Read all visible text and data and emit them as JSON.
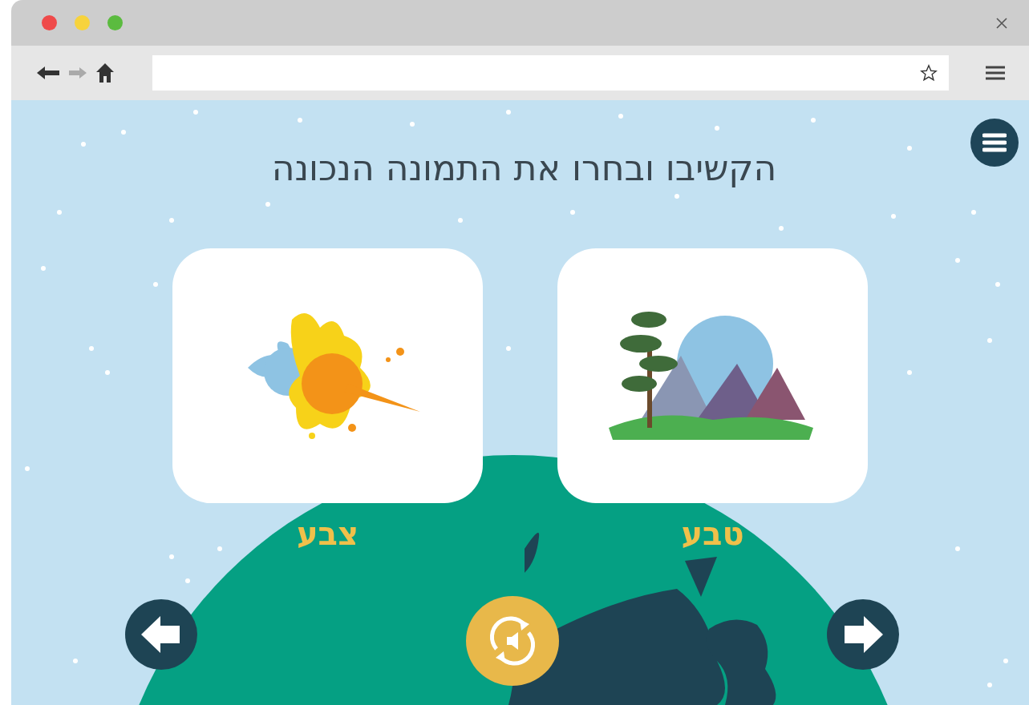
{
  "heading": "הקשיבו ובחרו את התמונה הנכונה",
  "options": [
    {
      "kind": "landscape",
      "label": "טבע"
    },
    {
      "kind": "splash",
      "label": "צבע"
    }
  ]
}
